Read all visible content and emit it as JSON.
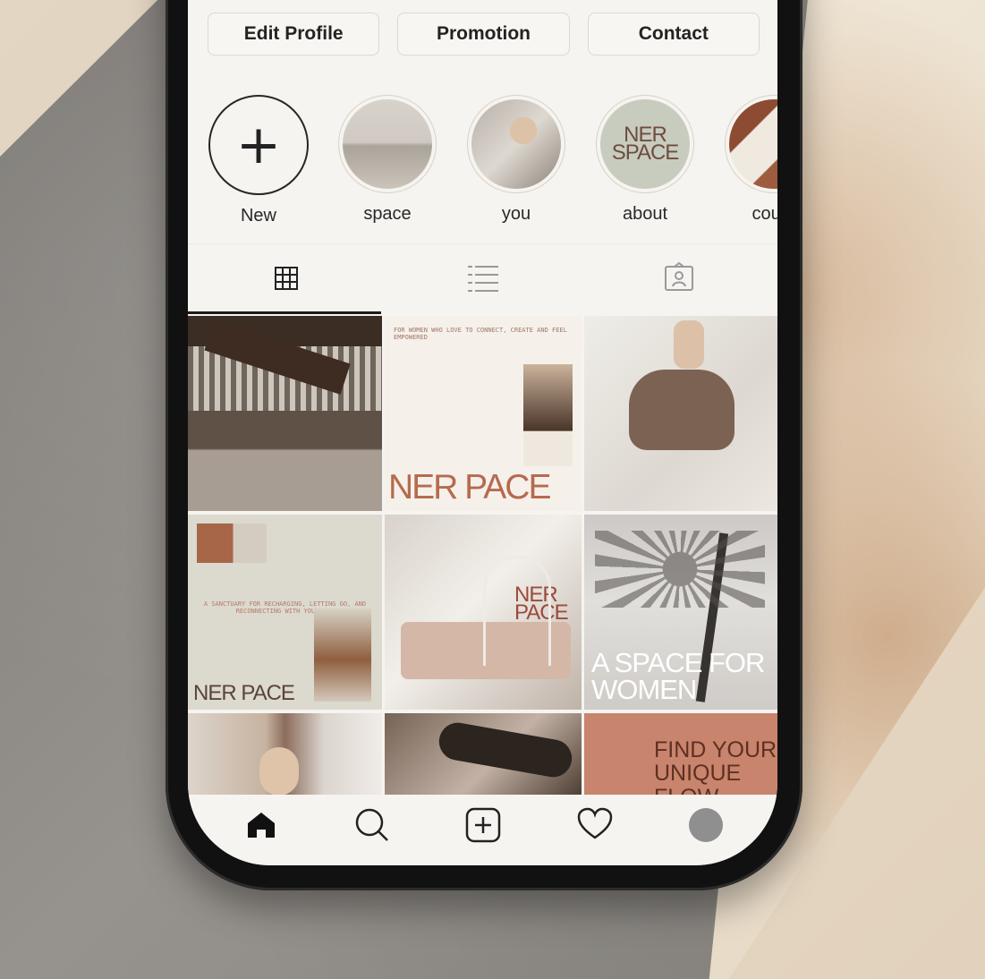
{
  "buttons": {
    "edit_profile": "Edit Profile",
    "promotion": "Promotion",
    "contact": "Contact"
  },
  "stories": [
    {
      "label": "New",
      "icon": "plus-icon"
    },
    {
      "label": "space",
      "icon": "story-space"
    },
    {
      "label": "you",
      "icon": "story-you"
    },
    {
      "label": "about",
      "icon": "story-about",
      "logo_text": "NER SPACE"
    },
    {
      "label": "cours",
      "icon": "story-course"
    }
  ],
  "tabs": [
    {
      "name": "grid",
      "icon": "grid-icon"
    },
    {
      "name": "list",
      "icon": "list-icon"
    },
    {
      "name": "tagged",
      "icon": "tagged-user-icon"
    }
  ],
  "grid_posts": [
    {
      "type": "photo",
      "text": ""
    },
    {
      "type": "brand",
      "text": "FOR WOMEN WHO LOVE TO CONNECT, CREATE AND FEEL EMPOWERED",
      "logo": "NER PACE"
    },
    {
      "type": "photo",
      "text": ""
    },
    {
      "type": "brand",
      "text": "A SANCTUARY FOR RECHARGING, LETTING GO, AND RECONNECTING WITH YOURSELF",
      "logo": "NER PACE"
    },
    {
      "type": "photo",
      "text": "NER PACE"
    },
    {
      "type": "photo",
      "text": "A SPACE FOR WOMEN"
    },
    {
      "type": "photo",
      "text": ""
    },
    {
      "type": "photo",
      "text": ""
    },
    {
      "type": "text",
      "text": "FIND YOUR UNIQUE FLOW"
    }
  ],
  "bottom_nav": [
    {
      "name": "home",
      "icon": "home-icon"
    },
    {
      "name": "search",
      "icon": "search-icon"
    },
    {
      "name": "create",
      "icon": "add-square-icon"
    },
    {
      "name": "activity",
      "icon": "heart-icon"
    },
    {
      "name": "profile",
      "icon": "avatar"
    }
  ],
  "colors": {
    "screen": "#f6f4f0",
    "accent": "#b66a4f",
    "text": "#232323"
  }
}
